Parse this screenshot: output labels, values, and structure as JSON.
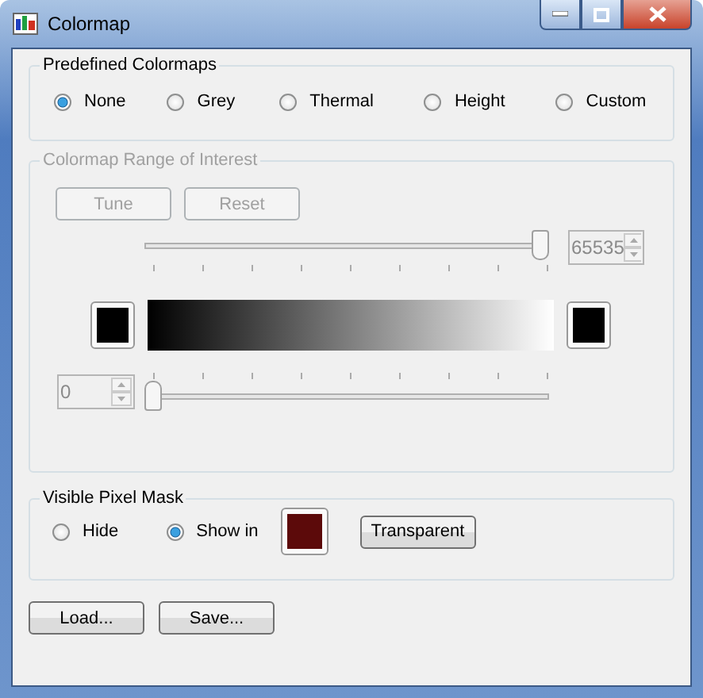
{
  "window": {
    "title": "Colormap"
  },
  "predefined": {
    "title": "Predefined Colormaps",
    "options": [
      {
        "label": "None",
        "selected": true
      },
      {
        "label": "Grey",
        "selected": false
      },
      {
        "label": "Thermal",
        "selected": false
      },
      {
        "label": "Height",
        "selected": false
      },
      {
        "label": "Custom",
        "selected": false
      }
    ]
  },
  "range": {
    "title": "Colormap Range of Interest",
    "disabled": true,
    "buttons": [
      "Tune",
      "Reset"
    ],
    "upper": {
      "value": "65535",
      "level": 1
    },
    "lower": {
      "value": "0",
      "level": 0
    },
    "swatches": [
      {
        "color": "#000000"
      },
      {
        "color": "#000000"
      }
    ]
  },
  "mask": {
    "title": "Visible Pixel Mask",
    "options": [
      {
        "label": "Hide",
        "selected": false
      },
      {
        "label": "Show in",
        "selected": true
      }
    ],
    "color": "#5c0a0a",
    "button": "Transparent"
  },
  "buttons": [
    "Load...",
    "Save..."
  ]
}
